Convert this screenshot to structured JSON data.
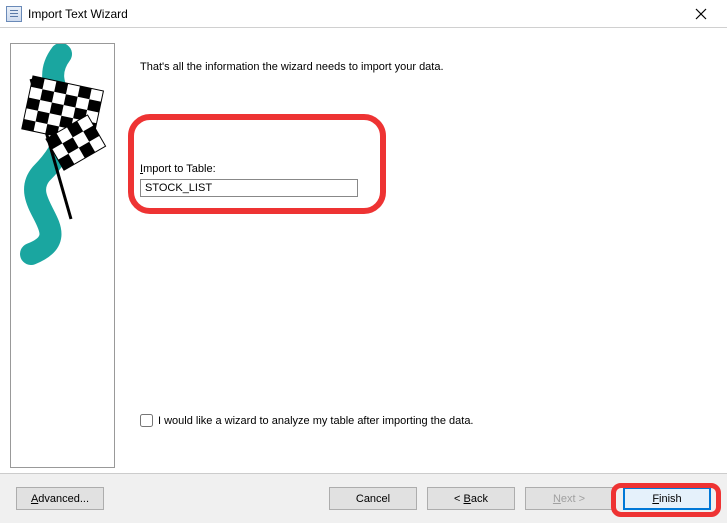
{
  "titlebar": {
    "title": "Import Text Wizard"
  },
  "main": {
    "info_text": "That's all the information the wizard needs to import your data.",
    "import_label_pre": "I",
    "import_label_rest": "mport to Table:",
    "import_value": "STOCK_LIST",
    "checkbox_label": "I would like a wizard to analyze my table after importing the data."
  },
  "buttons": {
    "advanced_pre": "A",
    "advanced_rest": "dvanced...",
    "cancel": "Cancel",
    "back_pre": "< ",
    "back_u": "B",
    "back_rest": "ack",
    "next_u": "N",
    "next_rest": "ext >",
    "finish_u": "F",
    "finish_rest": "inish"
  }
}
